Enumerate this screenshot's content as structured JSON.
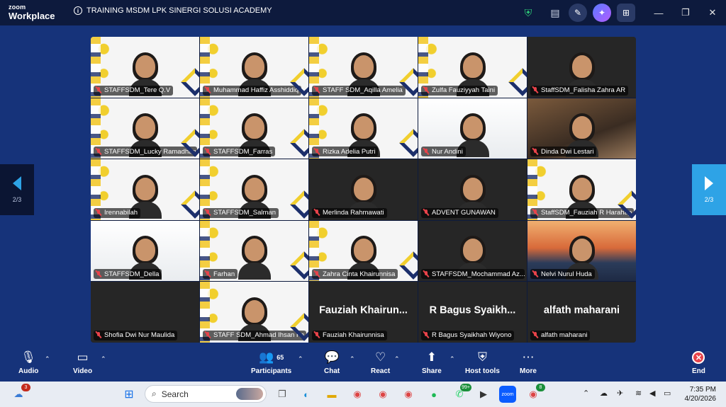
{
  "app": {
    "brand_top": "zoom",
    "brand_bottom": "Workplace"
  },
  "meeting": {
    "title": "TRAINING MSDM LPK SINERGI SOLUSI ACADEMY"
  },
  "colors": {
    "titlebar": "#0d1a3d",
    "background": "#16337a",
    "mic_off": "#e8434a",
    "accent": "#2ea3e6"
  },
  "pagination": {
    "prev_label": "2/3",
    "next_label": "2/3"
  },
  "participants_tiles": [
    {
      "name": "STAFFSDM_Tere Q.V",
      "bg": "slide"
    },
    {
      "name": "Muhammad Haffiz Asshiddiq",
      "bg": "slide"
    },
    {
      "name": "STAFF SDM_Aqilla Amelia",
      "bg": "slide"
    },
    {
      "name": "Zulfa Fauziyyah Taini",
      "bg": "slide"
    },
    {
      "name": "StaffSDM_Falisha Zahra AR",
      "bg": "dark"
    },
    {
      "name": "STAFFSDM_Lucky Ramadhan",
      "bg": "slide"
    },
    {
      "name": "STAFFSDM_Farras",
      "bg": "slide"
    },
    {
      "name": "Rizka Adelia Putri",
      "bg": "slide"
    },
    {
      "name": "Nur Andini",
      "bg": "white"
    },
    {
      "name": "Dinda Dwi Lestari",
      "bg": "room"
    },
    {
      "name": "Irennabilah",
      "bg": "slide"
    },
    {
      "name": "STAFFSDM_Salman",
      "bg": "slide"
    },
    {
      "name": "Merlinda Rahmawati",
      "bg": "dark"
    },
    {
      "name": "ADVENT GUNAWAN",
      "bg": "dark"
    },
    {
      "name": "StaffSDM_Fauziah R Harahap",
      "bg": "slide"
    },
    {
      "name": "STAFFSDM_Della",
      "bg": "white"
    },
    {
      "name": "Farhan",
      "bg": "slide"
    },
    {
      "name": "Zahra Cinta Khairunnisa",
      "bg": "slide"
    },
    {
      "name": "STAFFSDM_Mochammad Az...",
      "bg": "dark"
    },
    {
      "name": "Nelvi Nurul Huda",
      "bg": "sunset"
    },
    {
      "name": "Shofia Dwi Nur Maulida",
      "bg": "dark"
    },
    {
      "name": "STAFF SDM_Ahmad Ihsan Fa...",
      "bg": "slide"
    },
    {
      "name": "Fauziah Khairunnisa",
      "bg": "dark",
      "display": "Fauziah  Khairun..."
    },
    {
      "name": "R Bagus Syaikhah Wiyono",
      "bg": "dark",
      "display": "R  Bagus  Syaikh..."
    },
    {
      "name": "alfath maharani",
      "bg": "dark",
      "display": "alfath maharani"
    }
  ],
  "toolbar": {
    "audio": "Audio",
    "video": "Video",
    "participants": "Participants",
    "participants_count": "65",
    "chat": "Chat",
    "react": "React",
    "share": "Share",
    "host_tools": "Host tools",
    "more": "More",
    "end": "End"
  },
  "taskbar": {
    "search_placeholder": "Search",
    "weather_badge": "3",
    "whatsapp_badge": "99+",
    "chrome_badge": "8",
    "time": "7:35 PM",
    "date": "4/20/2026"
  }
}
